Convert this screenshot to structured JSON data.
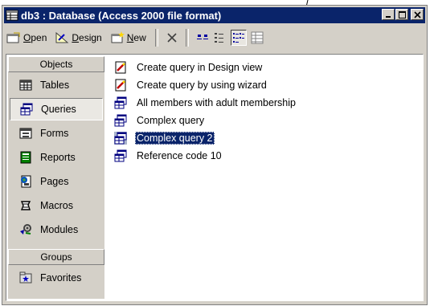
{
  "window": {
    "title": "db3 : Database (Access 2000 file format)",
    "controls": [
      "_",
      "□",
      "×"
    ],
    "accent": "#0a246a"
  },
  "toolbar": {
    "open_label": "Open",
    "design_label": "Design",
    "new_label": "New",
    "icons": [
      "delete-icon",
      "large-icons-view-icon",
      "small-icons-view-icon",
      "list-view-icon",
      "details-view-icon"
    ]
  },
  "sidebar": {
    "objects_header": "Objects",
    "groups_header": "Groups",
    "items": [
      {
        "label": "Tables",
        "icon": "table-icon"
      },
      {
        "label": "Queries",
        "icon": "query-icon",
        "active": true
      },
      {
        "label": "Forms",
        "icon": "form-icon"
      },
      {
        "label": "Reports",
        "icon": "report-icon"
      },
      {
        "label": "Pages",
        "icon": "page-icon"
      },
      {
        "label": "Macros",
        "icon": "macro-icon"
      },
      {
        "label": "Modules",
        "icon": "module-icon"
      }
    ],
    "groups": [
      {
        "label": "Favorites",
        "icon": "favorites-icon"
      }
    ]
  },
  "list": {
    "items": [
      {
        "label": "Create query in Design view",
        "icon": "wizard-icon"
      },
      {
        "label": "Create query by using wizard",
        "icon": "wizard-icon"
      },
      {
        "label": "All members with adult membership",
        "icon": "query-icon"
      },
      {
        "label": "Complex query",
        "icon": "query-icon"
      },
      {
        "label": "Complex query 2",
        "icon": "query-icon",
        "selected": true
      },
      {
        "label": "Reference code 10",
        "icon": "query-icon"
      }
    ]
  }
}
